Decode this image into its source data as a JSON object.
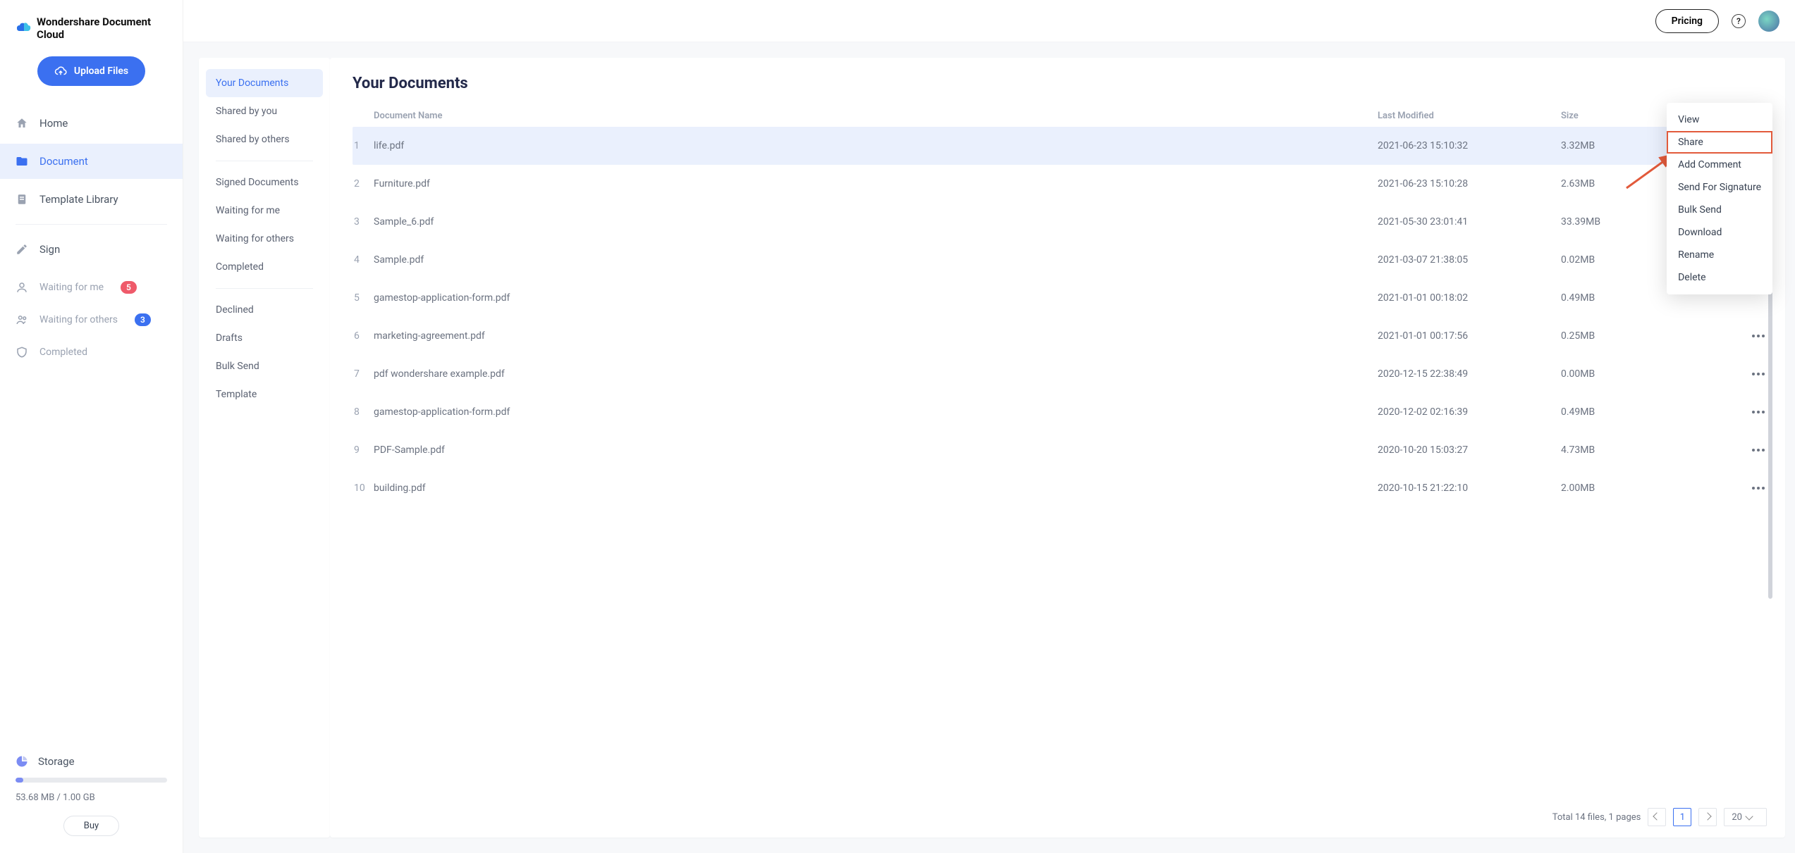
{
  "brand": {
    "name": "Wondershare Document Cloud"
  },
  "upload": {
    "label": "Upload Files"
  },
  "topbar": {
    "pricing": "Pricing"
  },
  "nav": [
    {
      "label": "Home",
      "icon": "home-icon",
      "active": false
    },
    {
      "label": "Document",
      "icon": "folder-icon",
      "active": true
    },
    {
      "label": "Template Library",
      "icon": "template-icon",
      "active": false
    }
  ],
  "sign_label": "Sign",
  "waits": [
    {
      "label": "Waiting for me",
      "badge": "5",
      "badge_class": "badge-red"
    },
    {
      "label": "Waiting for others",
      "badge": "3",
      "badge_class": "badge-blue"
    },
    {
      "label": "Completed",
      "badge": "",
      "badge_class": ""
    }
  ],
  "storage": {
    "label": "Storage",
    "text": "53.68 MB / 1.00 GB",
    "buy": "Buy"
  },
  "subnav": [
    {
      "label": "Your Documents",
      "active": true
    },
    {
      "label": "Shared by you"
    },
    {
      "label": "Shared by others"
    },
    {
      "divider": true
    },
    {
      "label": "Signed Documents"
    },
    {
      "label": "Waiting for me"
    },
    {
      "label": "Waiting for others"
    },
    {
      "label": "Completed"
    },
    {
      "divider": true
    },
    {
      "label": "Declined"
    },
    {
      "label": "Drafts"
    },
    {
      "label": "Bulk Send"
    },
    {
      "label": "Template"
    }
  ],
  "docs": {
    "title": "Your Documents",
    "headers": {
      "name": "Document Name",
      "modified": "Last Modified",
      "size": "Size"
    },
    "rows": [
      {
        "idx": "1",
        "name": "life.pdf",
        "modified": "2021-06-23 15:10:32",
        "size": "3.32MB",
        "active": true,
        "more": true
      },
      {
        "idx": "2",
        "name": "Furniture.pdf",
        "modified": "2021-06-23 15:10:28",
        "size": "2.63MB"
      },
      {
        "idx": "3",
        "name": "Sample_6.pdf",
        "modified": "2021-05-30 23:01:41",
        "size": "33.39MB"
      },
      {
        "idx": "4",
        "name": "Sample.pdf",
        "modified": "2021-03-07 21:38:05",
        "size": "0.02MB"
      },
      {
        "idx": "5",
        "name": "gamestop-application-form.pdf",
        "modified": "2021-01-01 00:18:02",
        "size": "0.49MB"
      },
      {
        "idx": "6",
        "name": "marketing-agreement.pdf",
        "modified": "2021-01-01 00:17:56",
        "size": "0.25MB",
        "more": true
      },
      {
        "idx": "7",
        "name": "pdf wondershare example.pdf",
        "modified": "2020-12-15 22:38:49",
        "size": "0.00MB",
        "more": true
      },
      {
        "idx": "8",
        "name": "gamestop-application-form.pdf",
        "modified": "2020-12-02 02:16:39",
        "size": "0.49MB",
        "more": true
      },
      {
        "idx": "9",
        "name": "PDF-Sample.pdf",
        "modified": "2020-10-20 15:03:27",
        "size": "4.73MB",
        "more": true
      },
      {
        "idx": "10",
        "name": "building.pdf",
        "modified": "2020-10-15 21:22:10",
        "size": "2.00MB",
        "more": true
      }
    ],
    "menu": [
      {
        "label": "View"
      },
      {
        "label": "Share",
        "highlight": true
      },
      {
        "label": "Add Comment"
      },
      {
        "label": "Send For Signature"
      },
      {
        "label": "Bulk Send"
      },
      {
        "label": "Download"
      },
      {
        "label": "Rename"
      },
      {
        "label": "Delete"
      }
    ],
    "pagination": {
      "summary": "Total 14 files, 1 pages",
      "page": "1",
      "page_size": "20"
    }
  },
  "colors": {
    "primary": "#3b70f0",
    "accent_bg": "#eaf0fd"
  }
}
